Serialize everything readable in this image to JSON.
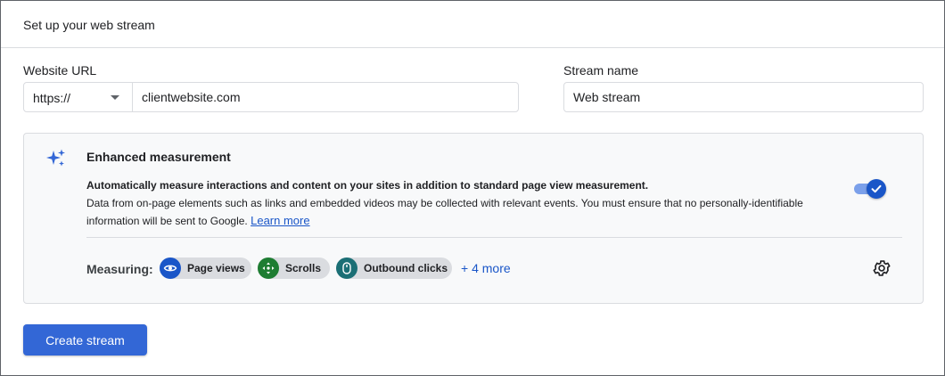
{
  "header": {
    "title": "Set up your web stream"
  },
  "website_url": {
    "label": "Website URL",
    "protocol": "https://",
    "value": "clientwebsite.com"
  },
  "stream_name": {
    "label": "Stream name",
    "value": "Web stream"
  },
  "enhanced_measurement": {
    "title": "Enhanced measurement",
    "description_bold": "Automatically measure interactions and content on your sites in addition to standard page view measurement.",
    "description": "Data from on-page elements such as links and embedded videos may be collected with relevant events. You must ensure that no personally-identifiable information will be sent to Google.",
    "learn_more": "Learn more",
    "enabled": true,
    "measuring_label": "Measuring:",
    "chips": [
      {
        "label": "Page views",
        "icon": "eye-icon",
        "color": "#1a56c8"
      },
      {
        "label": "Scrolls",
        "icon": "scroll-arrows-icon",
        "color": "#1e7d32"
      },
      {
        "label": "Outbound clicks",
        "icon": "mouse-icon",
        "color": "#1b6f75"
      }
    ],
    "more_link": "+ 4 more"
  },
  "actions": {
    "create_label": "Create stream"
  },
  "colors": {
    "accent": "#3367d6",
    "link": "#1a56c8"
  }
}
